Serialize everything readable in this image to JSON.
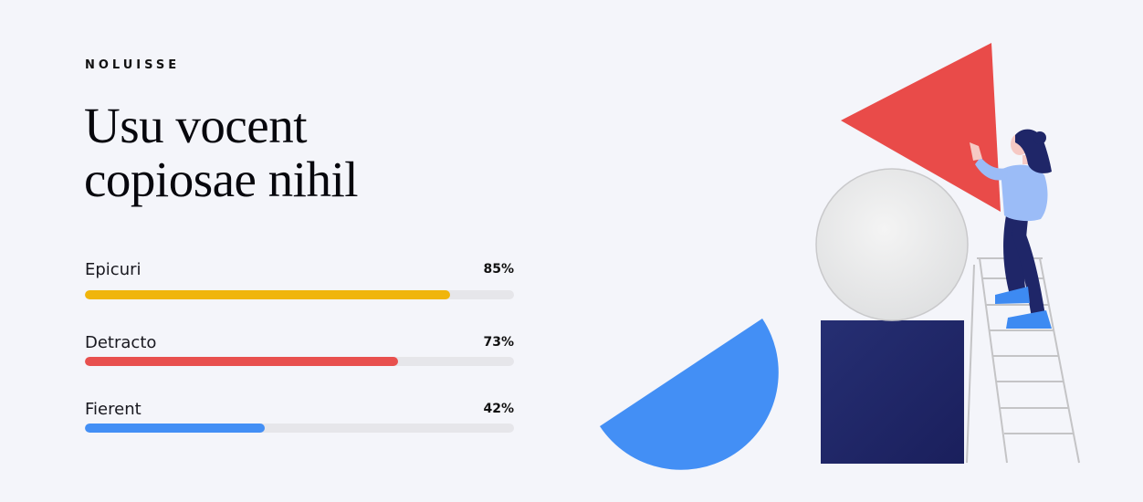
{
  "eyebrow": "NOLUISSE",
  "headline": {
    "line1": "Usu vocent",
    "line2": "copiosae nihil"
  },
  "skills": [
    {
      "label": "Epicuri",
      "value_text": "85%",
      "value": 0.85,
      "color": "#f0b50c"
    },
    {
      "label": "Detracto",
      "value_text": "73%",
      "value": 0.73,
      "color": "#e8504e"
    },
    {
      "label": "Fierent",
      "value_text": "42%",
      "value": 0.42,
      "color": "#438ff5"
    }
  ],
  "illustration": {
    "icons": [
      "red-triangle",
      "gray-circle",
      "navy-square",
      "blue-semicircle",
      "ladder",
      "woman-figure"
    ]
  }
}
